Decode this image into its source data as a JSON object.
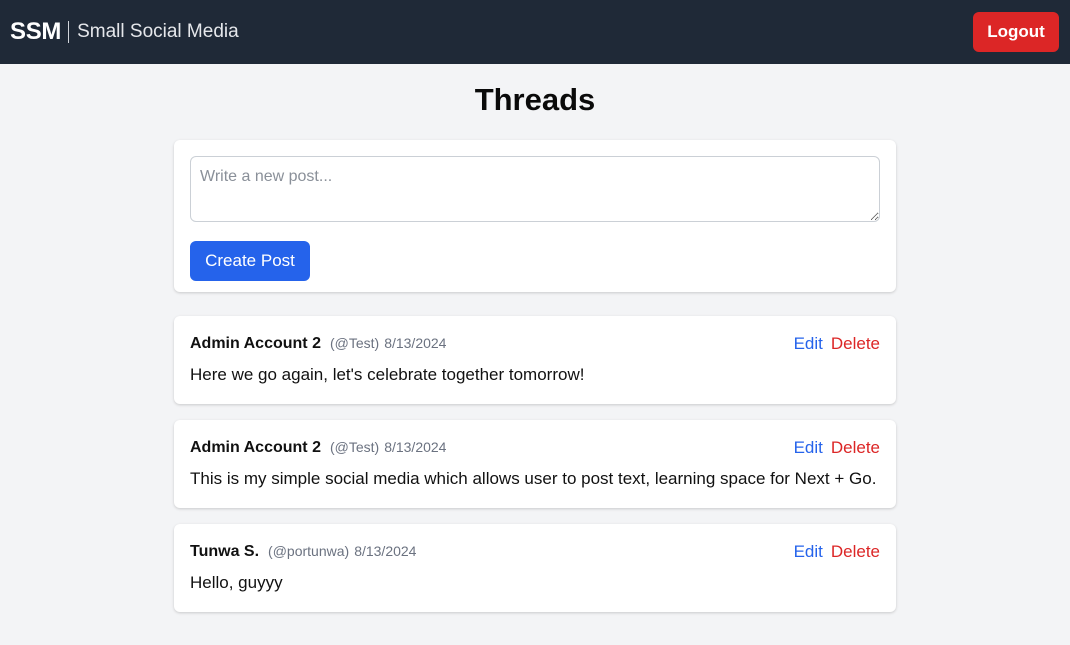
{
  "nav": {
    "brand_short": "SSM",
    "brand_full": "Small Social Media",
    "logout_label": "Logout"
  },
  "page": {
    "title": "Threads"
  },
  "composer": {
    "placeholder": "Write a new post...",
    "value": "",
    "submit_label": "Create Post"
  },
  "posts": [
    {
      "author": "Admin Account 2",
      "handle": "(@Test)",
      "date": "8/13/2024",
      "body": "Here we go again, let's celebrate together tomorrow!",
      "edit_label": "Edit",
      "delete_label": "Delete"
    },
    {
      "author": "Admin Account 2",
      "handle": "(@Test)",
      "date": "8/13/2024",
      "body": "This is my simple social media which allows user to post text, learning space for Next + Go.",
      "edit_label": "Edit",
      "delete_label": "Delete"
    },
    {
      "author": "Tunwa S.",
      "handle": "(@portunwa)",
      "date": "8/13/2024",
      "body": "Hello, guyyy",
      "edit_label": "Edit",
      "delete_label": "Delete"
    }
  ],
  "colors": {
    "navbar": "#1f2937",
    "logout": "#dc2626",
    "primary": "#2563eb",
    "background": "#f3f4f6"
  }
}
